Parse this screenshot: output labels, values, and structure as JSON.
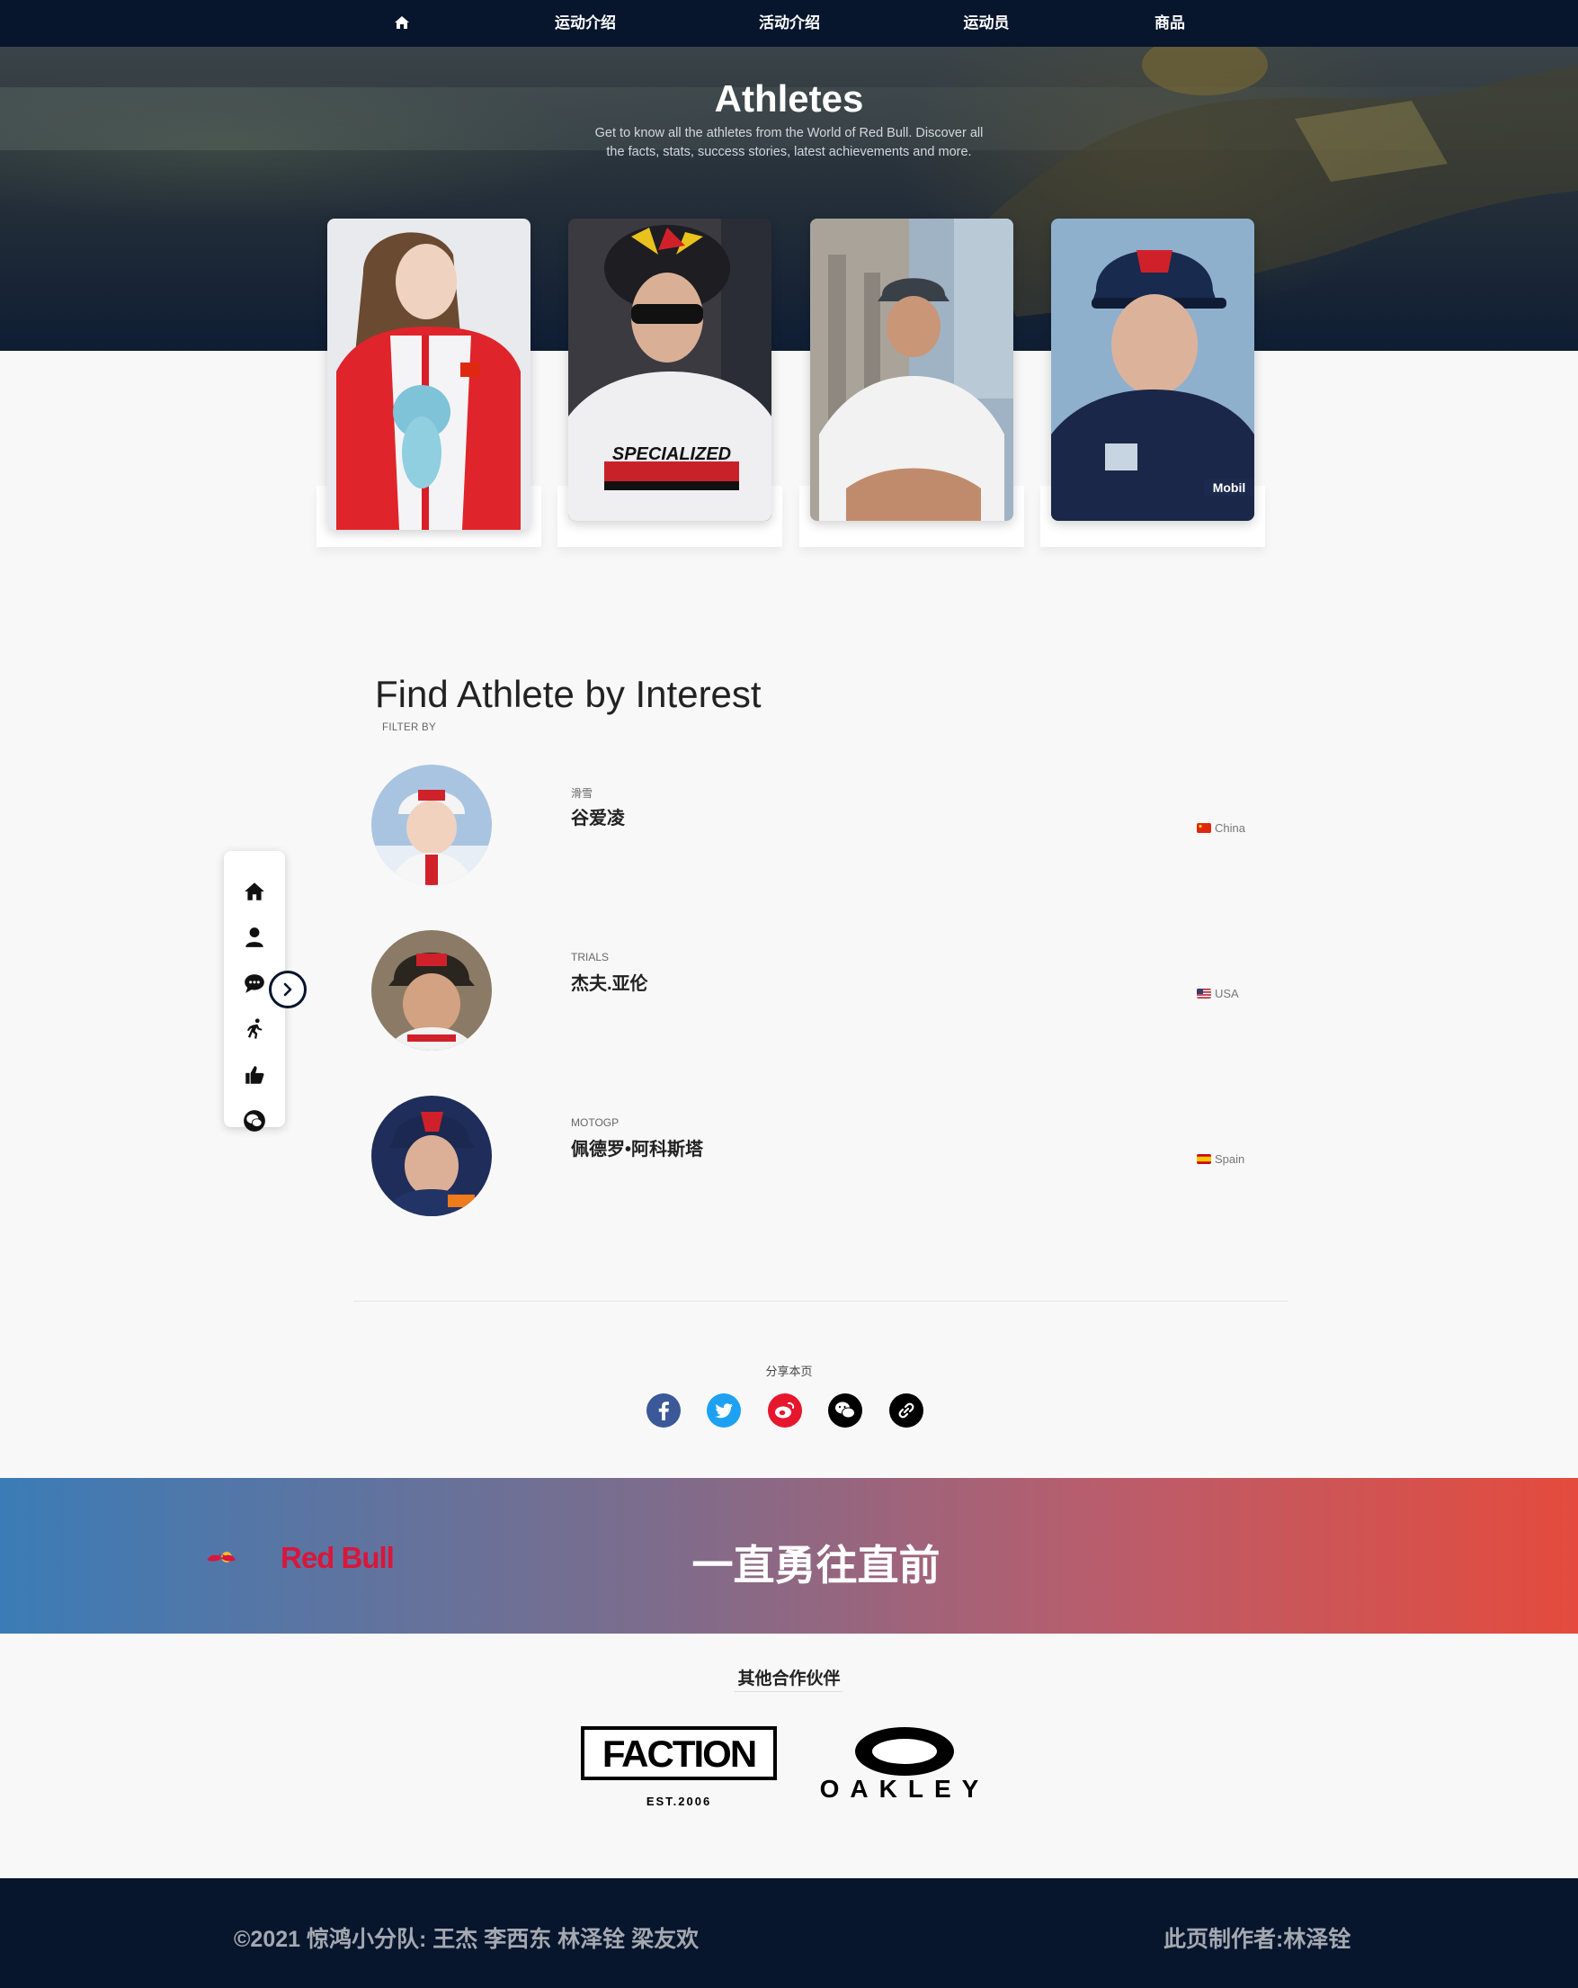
{
  "nav": {
    "home_icon": "home-icon",
    "items": [
      "运动介绍",
      "活动介绍",
      "运动员",
      "商品"
    ]
  },
  "hero": {
    "title": "Athletes",
    "subtitle": "Get to know all the athletes from the World of Red Bull. Discover all the facts, stats, success stories, latest achievements and more."
  },
  "featured_athletes": [
    {
      "photo": "freestyle-skier-photo"
    },
    {
      "photo": "cyclist-photo"
    },
    {
      "photo": "athlete-cap-photo"
    },
    {
      "photo": "f1-driver-photo"
    }
  ],
  "filter": {
    "title": "Find Athlete by Interest",
    "filter_label": "FILTER BY",
    "athletes": [
      {
        "sport": "滑雪",
        "name": "谷爱凌",
        "country": "China",
        "flag": "cn-flag"
      },
      {
        "sport": "TRIALS",
        "name": "杰夫.亚伦",
        "country": "USA",
        "flag": "us-flag"
      },
      {
        "sport": "MOTOGP",
        "name": "佩德罗•阿科斯塔",
        "country": "Spain",
        "flag": "es-flag"
      }
    ]
  },
  "sidebar": {
    "icons": [
      "home-icon",
      "user-icon",
      "chat-icon",
      "running-icon",
      "thumbs-up-icon",
      "wechat-icon"
    ],
    "toggle_icon": "chevron-right-icon"
  },
  "share": {
    "label": "分享本页",
    "buttons": [
      {
        "icon": "facebook-icon",
        "color": "#3b5998"
      },
      {
        "icon": "twitter-icon",
        "color": "#1da1f2"
      },
      {
        "icon": "weibo-icon",
        "color": "#e6162d"
      },
      {
        "icon": "wechat-icon",
        "color": "#000000"
      },
      {
        "icon": "link-icon",
        "color": "#000000"
      }
    ]
  },
  "banner": {
    "brand": "Red Bull",
    "slogan": "一直勇往直前"
  },
  "partners": {
    "title": "其他合作伙伴",
    "faction": {
      "name": "FACTION",
      "sub": "EST.2006"
    },
    "oakley": {
      "name": "OAKLEY"
    }
  },
  "footer": {
    "left": "©2021 惊鸿小分队: 王杰 李西东 林泽铨 梁友欢",
    "right": "此页制作者:林泽铨"
  },
  "colors": {
    "nav_bg": "#07152d",
    "redbull_red": "#d9163b",
    "banner_start": "#3b7cb6",
    "banner_end": "#e44b3d"
  }
}
